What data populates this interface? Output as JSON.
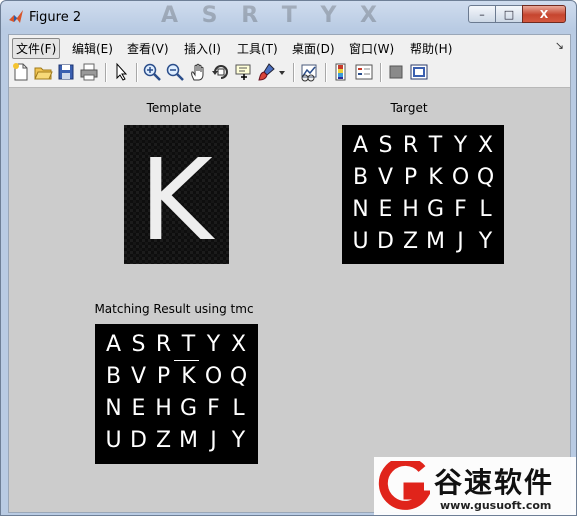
{
  "window": {
    "title": "Figure 2",
    "title_ghost": "A S R T Y X",
    "minimize_label": "–",
    "maximize_label": "□",
    "close_label": "X"
  },
  "menu": {
    "items": [
      {
        "label": "文件(F)",
        "active": true
      },
      {
        "label": "编辑(E)"
      },
      {
        "label": "查看(V)"
      },
      {
        "label": "插入(I)"
      },
      {
        "label": "工具(T)"
      },
      {
        "label": "桌面(D)"
      },
      {
        "label": "窗口(W)"
      },
      {
        "label": "帮助(H)"
      }
    ],
    "end_glyph": "↘"
  },
  "toolbar": {
    "buttons": [
      "new-figure-icon",
      "open-file-icon",
      "save-icon",
      "print-icon",
      "select-arrow-icon",
      "zoom-in-icon",
      "zoom-out-icon",
      "pan-hand-icon",
      "rotate-3d-icon",
      "data-cursor-icon",
      "brush-icon",
      "brush-dropdown-icon",
      "link-plot-icon",
      "colorbar-icon",
      "legend-icon",
      "hide-plot-tools-icon",
      "show-plot-tools-icon"
    ]
  },
  "plots": {
    "template": {
      "title": "Template",
      "letter": "K"
    },
    "target": {
      "title": "Target",
      "rows": [
        [
          "A",
          "S",
          "R",
          "T",
          "Y",
          "X"
        ],
        [
          "B",
          "V",
          "P",
          "K",
          "O",
          "Q"
        ],
        [
          "N",
          "E",
          "H",
          "G",
          "F",
          "L"
        ],
        [
          "U",
          "D",
          "Z",
          "M",
          "J",
          "Y"
        ]
      ]
    },
    "result": {
      "title": "Matching Result using tmc",
      "rows": [
        [
          "A",
          "S",
          "R",
          "T",
          "Y",
          "X"
        ],
        [
          "B",
          "V",
          "P",
          "K",
          "O",
          "Q"
        ],
        [
          "N",
          "E",
          "H",
          "G",
          "F",
          "L"
        ],
        [
          "U",
          "D",
          "Z",
          "M",
          "J",
          "Y"
        ]
      ]
    }
  },
  "watermark": {
    "text": "谷速软件",
    "url": "www.gusuoft.com",
    "logo_color": "#e0241b"
  }
}
